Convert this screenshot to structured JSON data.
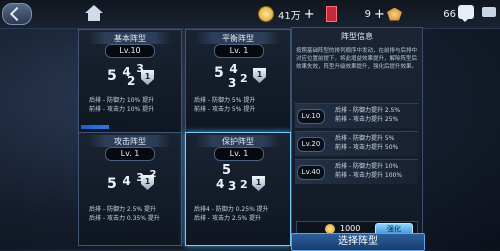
{
  "topbar": {
    "gold": "41万",
    "cards": "9",
    "gems": "66"
  },
  "formations": [
    {
      "title": "基本阵型",
      "level": "Lv.10",
      "digits": [
        "5",
        "4",
        "3",
        "2"
      ],
      "shield": "1",
      "line1": "后排 - 防御力 10% 提升",
      "line2": "前排 - 攻击力 10% 提升",
      "progress": 0.3
    },
    {
      "title": "平衡阵型",
      "level": "Lv. 1",
      "digits": [
        "5",
        "4",
        "3",
        "2"
      ],
      "shield": "1",
      "line1": "后排 - 防御力 5% 提升",
      "line2": "前排 - 攻击力 5% 提升",
      "progress": 0
    },
    {
      "title": "攻击阵型",
      "level": "Lv. 1",
      "digits": [
        "5",
        "4",
        "3",
        "2"
      ],
      "shield": "1",
      "line1": "后排 - 防御力 2.5% 提升",
      "line2": "后排 - 攻击力 0.35% 提升",
      "progress": 0
    },
    {
      "title": "保护阵型",
      "level": "Lv. 1",
      "digits": [
        "5",
        "4",
        "3",
        "2"
      ],
      "shield": "1",
      "line1": "后排4 - 防御力 0.25% 提升",
      "line2": "后排 - 攻击力 2.5% 提升",
      "progress": 0
    }
  ],
  "panel": {
    "title": "阵型信息",
    "description": "按照基础阵型的排列顺序中发动，在前排与后排中对应位置前提下，将此增益效果提升，解除阵型后效果失效，阵型升级效果提升，强化后提升效果。",
    "levels": [
      {
        "badge": "Lv.10",
        "line1": "后排 - 防御力提升 2.5%",
        "line2": "前排 - 攻击力提升 25%"
      },
      {
        "badge": "Lv.20",
        "line1": "后排 - 防御力提升 5%",
        "line2": "前排 - 攻击力提升 50%"
      },
      {
        "badge": "Lv.40",
        "line1": "后排 - 防御力提升 10%",
        "line2": "前排 - 攻击力提升 100%"
      }
    ],
    "cost": "1000",
    "upgrade_label": "强化"
  },
  "choose_label": "选择阵型"
}
